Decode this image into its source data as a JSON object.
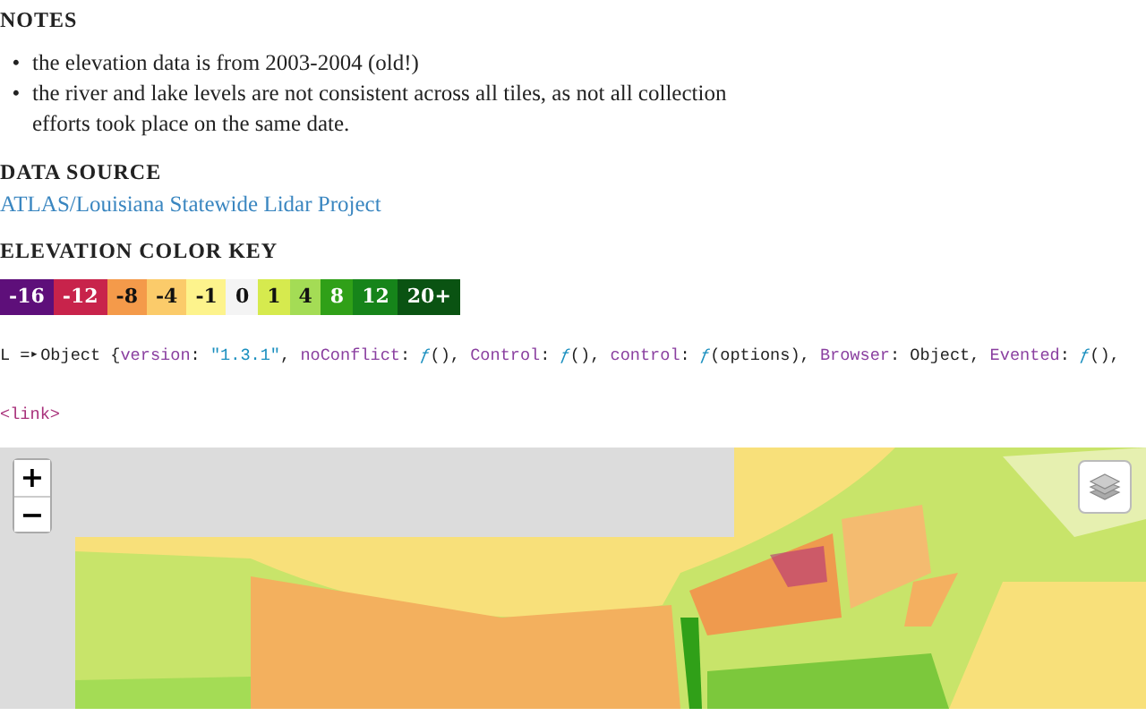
{
  "notes": {
    "heading": "NOTES",
    "items": [
      {
        "bullet": "•",
        "text": "the elevation data is from 2003-2004 (old!)"
      },
      {
        "bullet": "•",
        "text": "the river and lake levels are not consistent across all tiles, as not all collection efforts took place on the same date."
      }
    ]
  },
  "data_source": {
    "heading": "DATA SOURCE",
    "link": "ATLAS/Louisiana Statewide Lidar Project"
  },
  "color_key": {
    "heading": "ELEVATION COLOR KEY",
    "items": [
      {
        "label": "-16",
        "color": "#5e0f7a"
      },
      {
        "label": "-12",
        "color": "#c8234b"
      },
      {
        "label": "-8",
        "color": "#f49a4a"
      },
      {
        "label": "-4",
        "color": "#fbcb6a"
      },
      {
        "label": "-1",
        "color": "#fdf38c"
      },
      {
        "label": "0",
        "color": "#f4f4f4"
      },
      {
        "label": "1",
        "color": "#d6ea4e"
      },
      {
        "label": "4",
        "color": "#a4dc55"
      },
      {
        "label": "8",
        "color": "#30a018"
      },
      {
        "label": "12",
        "color": "#16841a"
      },
      {
        "label": "20+",
        "color": "#0a5312"
      }
    ]
  },
  "console": {
    "prefix": "L = ",
    "toggle": "▸",
    "segments": [
      {
        "kind": "plain",
        "text": "Object {"
      },
      {
        "kind": "key",
        "text": "version"
      },
      {
        "kind": "plain",
        "text": ": "
      },
      {
        "kind": "string",
        "text": "\"1.3.1\""
      },
      {
        "kind": "plain",
        "text": ", "
      },
      {
        "kind": "key",
        "text": "noConflict"
      },
      {
        "kind": "plain",
        "text": ": "
      },
      {
        "kind": "fn",
        "text": "ƒ"
      },
      {
        "kind": "plain",
        "text": "(), "
      },
      {
        "kind": "key",
        "text": "Control"
      },
      {
        "kind": "plain",
        "text": ": "
      },
      {
        "kind": "fn",
        "text": "ƒ"
      },
      {
        "kind": "plain",
        "text": "(), "
      },
      {
        "kind": "key",
        "text": "control"
      },
      {
        "kind": "plain",
        "text": ": "
      },
      {
        "kind": "fn",
        "text": "ƒ"
      },
      {
        "kind": "plain",
        "text": "(options), "
      },
      {
        "kind": "key",
        "text": "Browser"
      },
      {
        "kind": "plain",
        "text": ": Object, "
      },
      {
        "kind": "key",
        "text": "Evented"
      },
      {
        "kind": "plain",
        "text": ": "
      },
      {
        "kind": "fn",
        "text": "ƒ"
      },
      {
        "kind": "plain",
        "text": "(),"
      }
    ],
    "tag": "<link>"
  },
  "map": {
    "zoom_in": "+",
    "zoom_out": "−"
  }
}
